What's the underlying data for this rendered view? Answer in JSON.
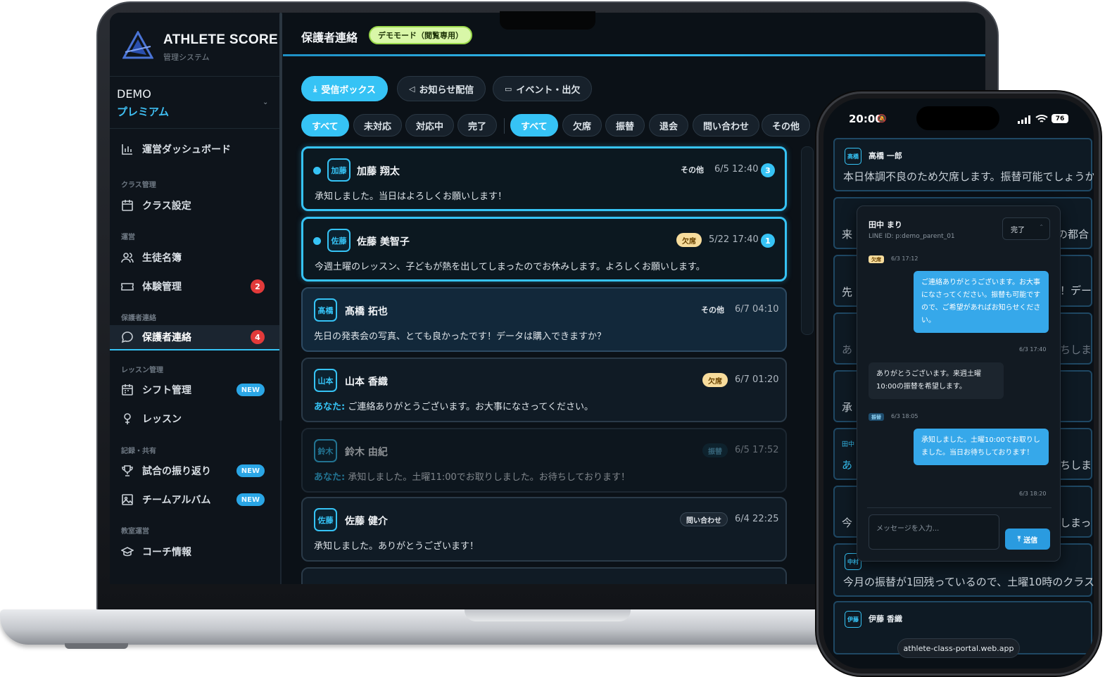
{
  "app": {
    "brand": "ATHLETE SCORE",
    "brand_sub": "管理システム",
    "org": "DEMO",
    "plan": "プレミアム"
  },
  "sidebar": {
    "dashboard": "運営ダッシュボード",
    "sec_class": "クラス管理",
    "class_settings": "クラス設定",
    "sec_ops": "運営",
    "students": "生徒名簿",
    "trial": "体験管理",
    "trial_badge": "2",
    "sec_parent": "保護者連絡",
    "parent_contact": "保護者連絡",
    "parent_badge": "4",
    "sec_lesson": "レッスン管理",
    "shift": "シフト管理",
    "shift_badge": "NEW",
    "lesson": "レッスン",
    "sec_record": "記録・共有",
    "review": "試合の振り返り",
    "review_badge": "NEW",
    "album": "チームアルバム",
    "album_badge": "NEW",
    "sec_school": "教室運営",
    "coach": "コーチ情報"
  },
  "header": {
    "title": "保護者連絡",
    "demo": "デモモード（閲覧専用）"
  },
  "tabs": [
    "受信ボックス",
    "お知らせ配信",
    "イベント・出欠"
  ],
  "status_filters": [
    "すべて",
    "未対応",
    "対応中",
    "完了"
  ],
  "type_filters": [
    "すべて",
    "欠席",
    "振替",
    "退会",
    "問い合わせ",
    "その他"
  ],
  "messages": [
    {
      "avatar": "加藤",
      "name": "加藤 翔太",
      "tag": "その他",
      "time": "6/5 12:40",
      "count": "3",
      "you": "",
      "text": "承知しました。当日はよろしくお願いします！"
    },
    {
      "avatar": "佐藤",
      "name": "佐藤 美智子",
      "tag": "欠席",
      "time": "5/22 17:40",
      "count": "1",
      "you": "",
      "text": "今週土曜のレッスン、子どもが熱を出してしまったのでお休みします。よろしくお願いします。"
    },
    {
      "avatar": "髙橋",
      "name": "髙橋 拓也",
      "tag": "その他",
      "time": "6/7 04:10",
      "count": "",
      "you": "",
      "text": "先日の発表会の写真、とても良かったです！データは購入できますか？"
    },
    {
      "avatar": "山本",
      "name": "山本 香織",
      "tag": "欠席",
      "time": "6/7 01:20",
      "count": "",
      "you": "あなた:",
      "text": " ご連絡ありがとうございます。お大事になさってください。"
    },
    {
      "avatar": "鈴木",
      "name": "鈴木 由紀",
      "tag": "振替",
      "time": "6/5 17:52",
      "count": "",
      "you": "あなた:",
      "text": " 承知しました。土曜11:00でお取りしました。お待ちしております！"
    },
    {
      "avatar": "佐藤",
      "name": "佐藤 健介",
      "tag": "問い合わせ",
      "time": "6/4 22:25",
      "count": "",
      "you": "",
      "text": "承知しました。ありがとうございます！"
    }
  ],
  "phone": {
    "time": "20:00",
    "battery": "76",
    "bg_cards": [
      {
        "avatar": "高橋",
        "name": "高橋 一郎",
        "text": "本日体調不良のため欠席します。振替可能でしょうか"
      },
      {
        "avatar": "中村",
        "name": "",
        "text": "今月の振替が1回残っているので、土曜10時のクラス"
      },
      {
        "avatar": "伊藤",
        "name": "伊藤 香織",
        "text": ""
      }
    ],
    "bg_fragments": [
      "来",
      "の都合",
      "先",
      "！デー",
      "あ",
      "ちしま",
      "承",
      "田中",
      "あ",
      "ちしま",
      "今",
      "しまっ"
    ],
    "chat": {
      "name": "田中 まり",
      "line_id": "LINE ID: p:demo_parent_01",
      "status": "完了",
      "t1_tag": "欠席",
      "t1_time": "6/3 17:12",
      "b1": "ご連絡ありがとうございます。お大事になさってください。振替も可能ですので、ご希望があればお知らせください。",
      "b1_time": "6/3 17:40",
      "b2": "ありがとうございます。来週土曜10:00の振替を希望します。",
      "t2_tag": "振替",
      "t2_time": "6/3 18:05",
      "b3": "承知しました。土曜10:00でお取りしました。当日お待ちしております！",
      "b3_time": "6/3 18:20",
      "placeholder": "メッセージを入力...",
      "send": "送信"
    },
    "url": "athlete-class-portal.web.app"
  },
  "colors": {
    "accent": "#36c3f5",
    "bg": "#0b1117",
    "badge_red": "#e23a3a",
    "demo_pill": "#d9f7a8"
  },
  "icons": [
    "chart-icon",
    "calendar-icon",
    "users-icon",
    "ticket-icon",
    "chat-icon",
    "pin-icon",
    "trophy-icon",
    "image-icon",
    "graduation-icon",
    "inbox-icon",
    "megaphone-icon"
  ]
}
